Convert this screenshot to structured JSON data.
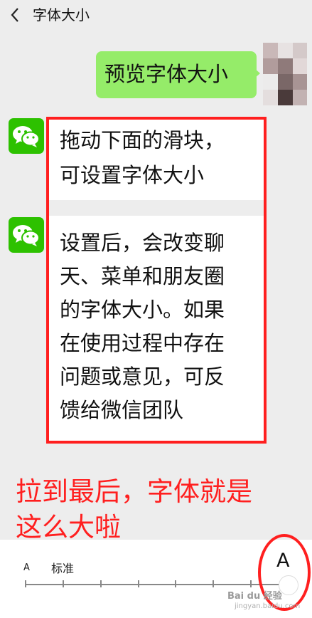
{
  "header": {
    "back_glyph": "‹",
    "title": "字体大小"
  },
  "chat": {
    "outgoing_message": "预览字体大小",
    "incoming_1_lines": [
      "拖动下面的滑块，",
      "可设置字体大小"
    ],
    "incoming_2_lines": [
      "设置后，会改变聊",
      "天、菜单和朋友圈",
      "的字体大小。如果",
      "在使用过程中存在",
      "问题或意见，可反",
      "馈给微信团队"
    ]
  },
  "annotation": {
    "caption_lines": [
      "拉到最后，字体就是",
      "这么大啦"
    ]
  },
  "font_panel": {
    "small_a": "A",
    "standard_label": "标准",
    "large_a": "A",
    "slider_position": "max",
    "slider_steps": 8,
    "slider_value_index": 7
  },
  "watermark": {
    "text": "Bai du 经验",
    "sub": "jingyan.baidu.com"
  },
  "colors": {
    "bubble_green": "#95ec69",
    "wechat_green": "#2dc100",
    "highlight_red": "#ff1f1f",
    "background": "#ededed"
  },
  "icons": {
    "back": "chevron-left-icon",
    "wechat": "wechat-logo-icon"
  }
}
